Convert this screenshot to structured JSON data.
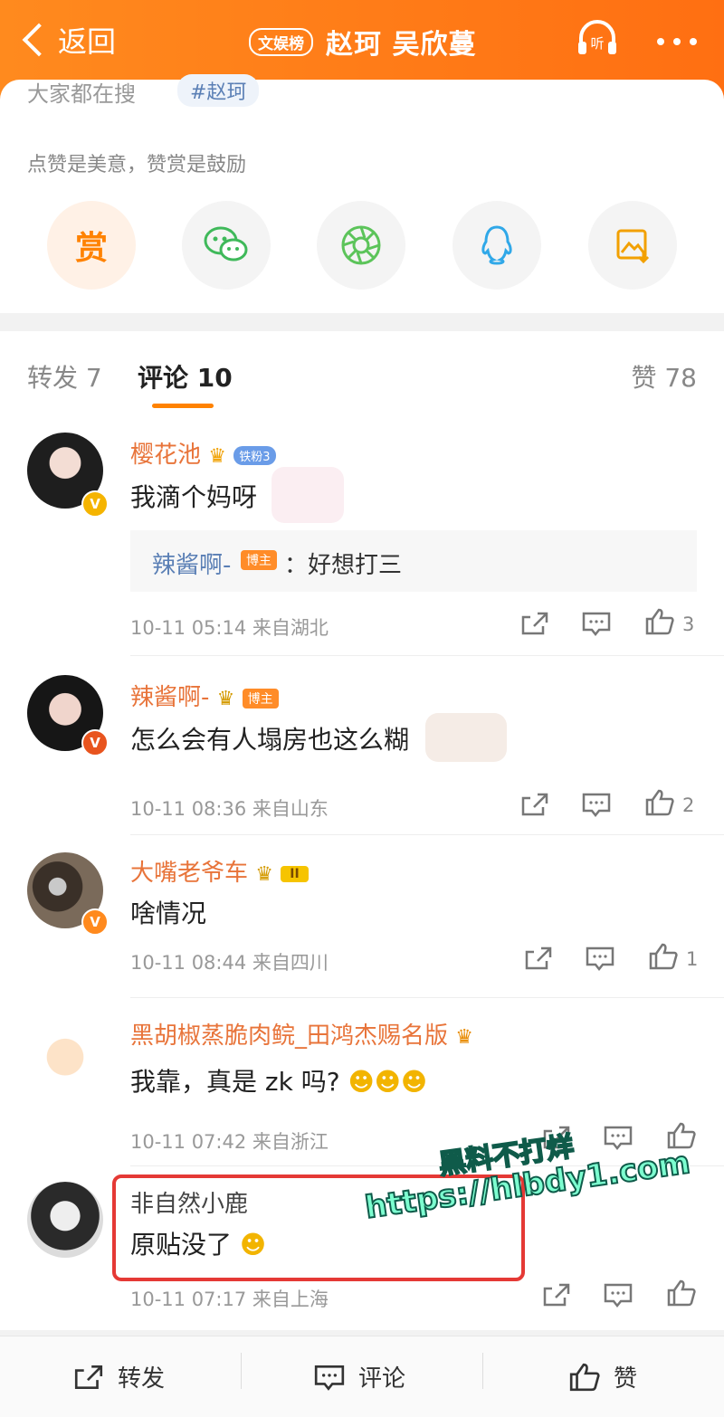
{
  "header": {
    "back_label": "返回",
    "channel_badge": "文娱榜",
    "title": "赵珂 吴欣蔓",
    "listen_label": "听"
  },
  "top_card": {
    "hot_search_label": "大家都在搜",
    "hot_tag": "#赵珂",
    "reward_prompt": "点赞是美意，赞赏是鼓励",
    "reward_button": "赏",
    "share_icons": [
      "wechat-icon",
      "moments-icon",
      "qq-icon",
      "save-image-icon"
    ]
  },
  "tabs": {
    "repost": "转发 7",
    "comment": "评论 10",
    "like": "赞 78"
  },
  "comments": [
    {
      "name": "樱花池",
      "fan_badge": "铁粉3",
      "text": "我滴个妈呀",
      "reply_name": "辣酱啊-",
      "reply_badge": "博主",
      "reply_text": "：好想打三",
      "meta": "10-11 05:14 来自湖北",
      "likes": "3"
    },
    {
      "name": "辣酱啊-",
      "badge": "博主",
      "text": "怎么会有人塌房也这么糊",
      "meta": "10-11 08:36 来自山东",
      "likes": "2"
    },
    {
      "name": "大嘴老爷车",
      "level_badge": "II",
      "text": "啥情况",
      "meta": "10-11 08:44 来自四川",
      "likes": "1"
    },
    {
      "name": "黑胡椒蒸脆肉鲩_田鸿杰赐名版",
      "text": "我靠，真是 zk 吗?",
      "meta": "10-11 07:42 来自浙江",
      "likes": ""
    },
    {
      "name": "非自然小鹿",
      "text": "原贴没了",
      "meta": "10-11 07:17 来自上海",
      "likes": ""
    }
  ],
  "watermark": {
    "line1": "黑料不打烊",
    "line2": "https://hlbdy1.com"
  },
  "bottom_bar": {
    "repost": "转发",
    "comment": "评论",
    "like": "赞"
  },
  "colors": {
    "brand_orange": "#ff7a16",
    "name_orange": "#e8743a",
    "highlight_red": "#e53935"
  }
}
